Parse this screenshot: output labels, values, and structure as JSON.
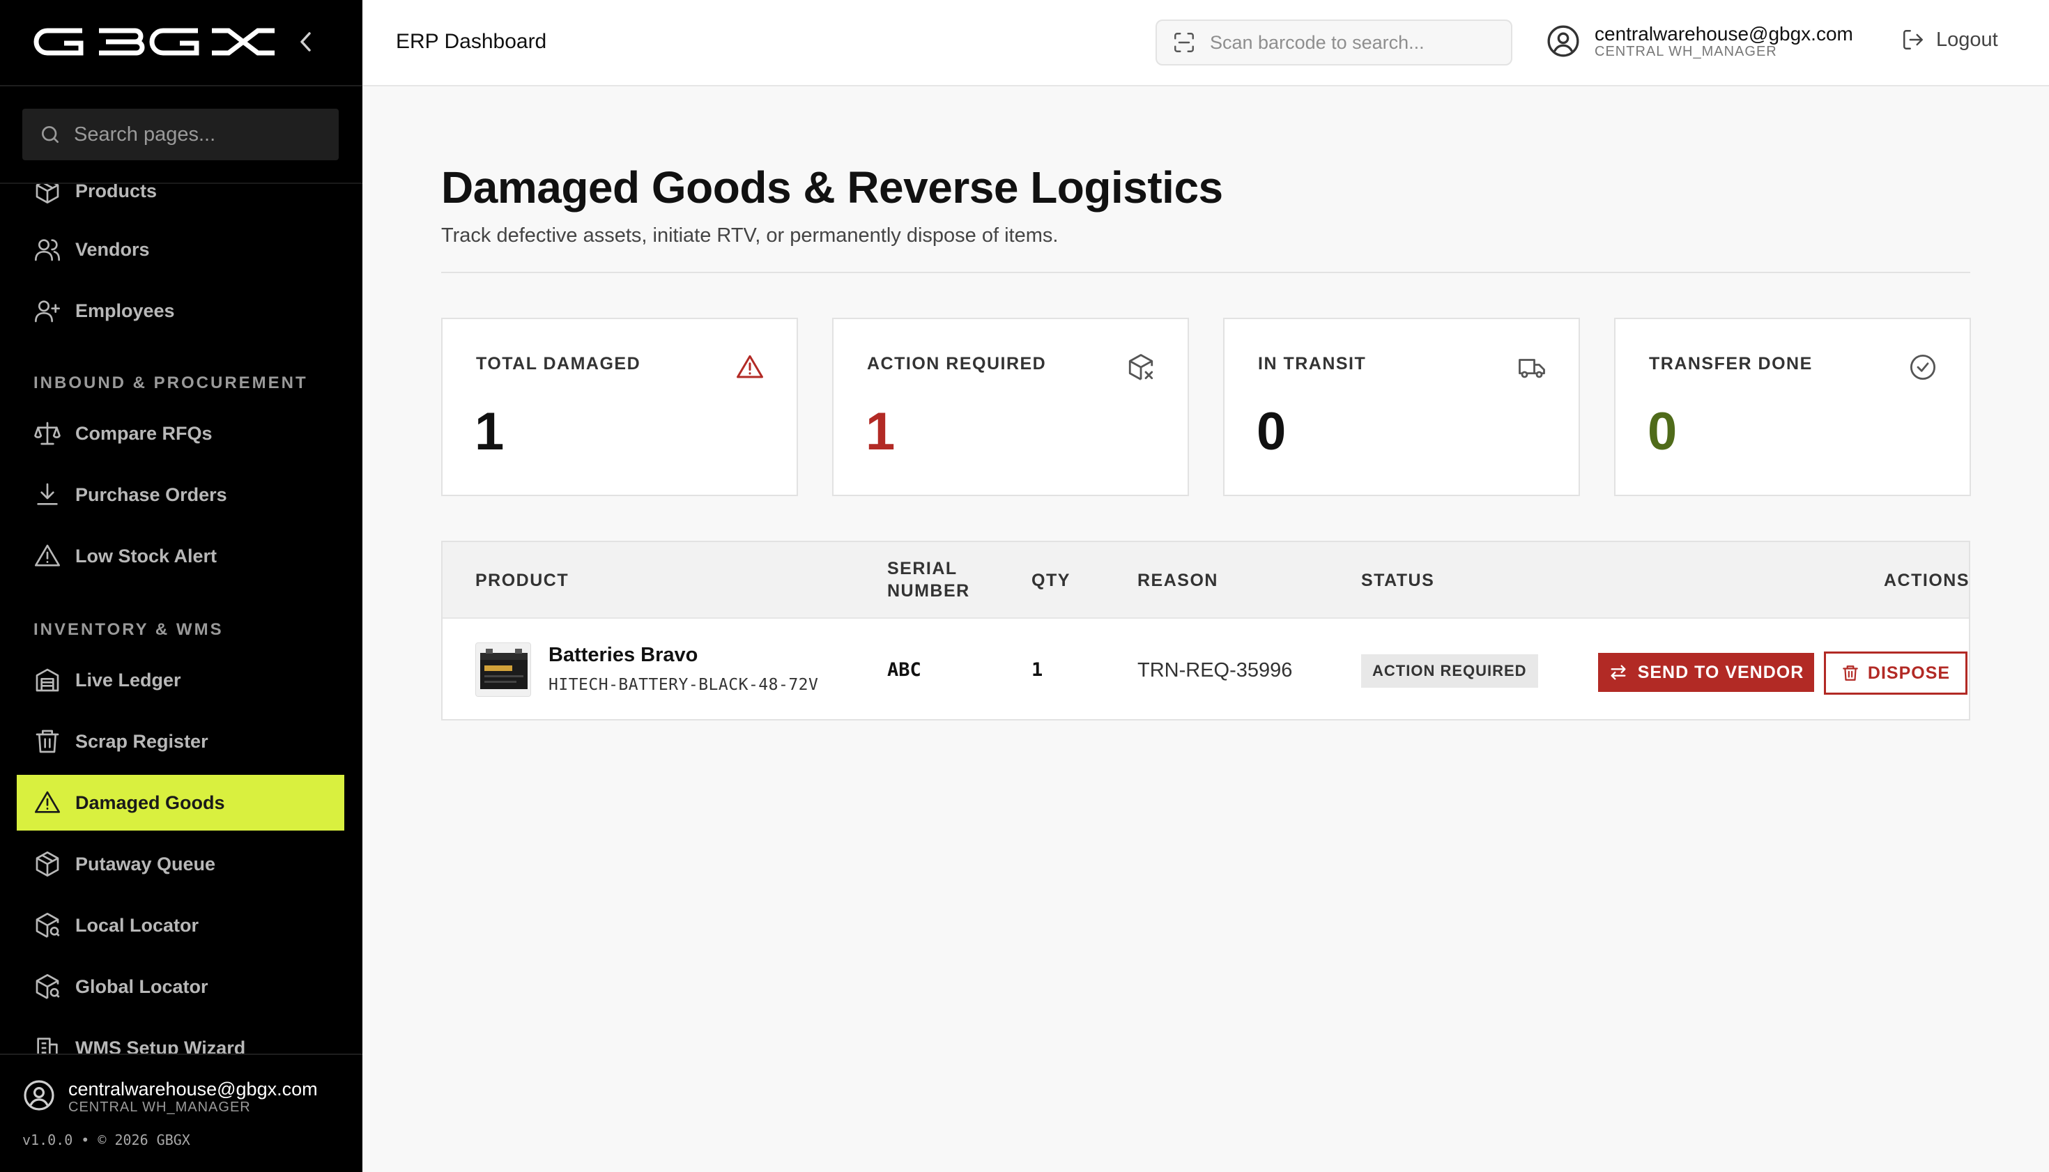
{
  "sidebar": {
    "search_placeholder": "Search pages...",
    "items_top": [
      {
        "label": "Products",
        "icon": "package-icon"
      },
      {
        "label": "Vendors",
        "icon": "users-icon"
      },
      {
        "label": "Employees",
        "icon": "user-plus-icon"
      }
    ],
    "section_inbound": "INBOUND & PROCUREMENT",
    "items_inbound": [
      {
        "label": "Compare RFQs",
        "icon": "scale-icon"
      },
      {
        "label": "Purchase Orders",
        "icon": "download-icon"
      },
      {
        "label": "Low Stock Alert",
        "icon": "alert-triangle-icon"
      }
    ],
    "section_inventory": "INVENTORY & WMS",
    "items_inventory": [
      {
        "label": "Live Ledger",
        "icon": "warehouse-icon"
      },
      {
        "label": "Scrap Register",
        "icon": "trash-icon"
      },
      {
        "label": "Damaged Goods",
        "icon": "alert-triangle-icon",
        "active": true
      },
      {
        "label": "Putaway Queue",
        "icon": "package-icon"
      },
      {
        "label": "Local Locator",
        "icon": "package-search-icon"
      },
      {
        "label": "Global Locator",
        "icon": "package-search-icon"
      },
      {
        "label": "WMS Setup Wizard",
        "icon": "building-icon"
      }
    ],
    "user_email": "centralwarehouse@gbgx.com",
    "user_role": "CENTRAL WH_MANAGER",
    "version": "v1.0.0 • © 2026 GBGX",
    "active_color": "#d9f03f"
  },
  "header": {
    "title": "ERP Dashboard",
    "scan_placeholder": "Scan barcode to search...",
    "user_email": "centralwarehouse@gbgx.com",
    "user_role": "CENTRAL WH_MANAGER",
    "logout_label": "Logout"
  },
  "main": {
    "title": "Damaged Goods & Reverse Logistics",
    "subtitle": "Track defective assets, initiate RTV, or permanently dispose of items.",
    "stats": [
      {
        "label": "TOTAL DAMAGED",
        "value": "1",
        "icon": "alert-triangle-icon",
        "color": "#111111"
      },
      {
        "label": "ACTION REQUIRED",
        "value": "1",
        "icon": "package-x-icon",
        "color": "#b22a25"
      },
      {
        "label": "IN TRANSIT",
        "value": "0",
        "icon": "truck-icon",
        "color": "#111111"
      },
      {
        "label": "TRANSFER DONE",
        "value": "0",
        "icon": "check-circle-icon",
        "color": "#4f6b1a"
      }
    ],
    "table": {
      "headers": {
        "product": "PRODUCT",
        "serial_1": "SERIAL",
        "serial_2": "NUMBER",
        "qty": "QTY",
        "reason": "REASON",
        "status": "STATUS",
        "actions": "ACTIONS"
      },
      "rows": [
        {
          "product_name": "Batteries Bravo",
          "sku": "HITECH-BATTERY-BLACK-48-72V",
          "serial": "ABC",
          "qty": "1",
          "reason": "TRN-REQ-35996",
          "status": "ACTION REQUIRED",
          "send_label": "SEND TO VENDOR",
          "dispose_label": "DISPOSE"
        }
      ]
    },
    "danger_color": "#b22a25"
  }
}
